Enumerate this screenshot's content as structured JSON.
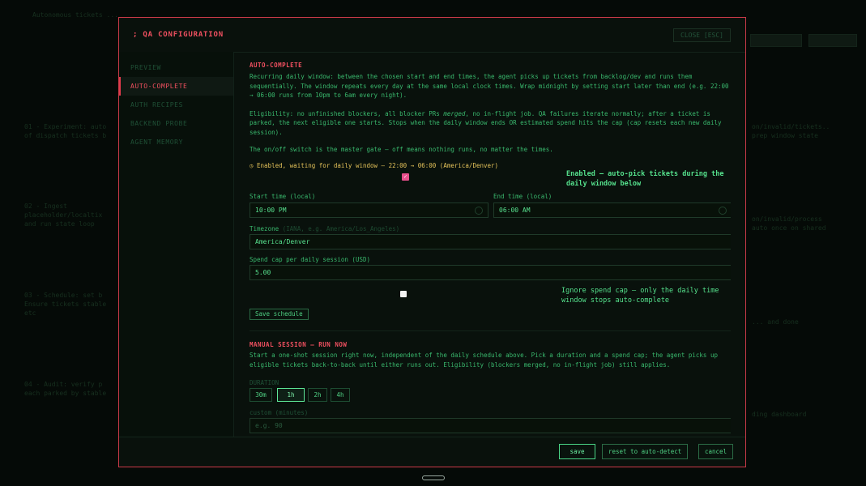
{
  "background": {
    "lines": [
      {
        "text": "Autonomous tickets ..."
      },
      {
        "text": "01 - Experiment: auto",
        "cls": "a"
      },
      {
        "text": "of dispatch tickets b"
      },
      {
        "text": "02 - Ingest"
      },
      {
        "text": "placeholder/localtix"
      },
      {
        "text": "and run state loop"
      },
      {
        "text": "03 - Schedule: set b"
      },
      {
        "text": "Ensure tickets stable"
      },
      {
        "text": "etc"
      },
      {
        "text": "04 - Audit: verify p"
      },
      {
        "text": "each parked by stable"
      },
      {
        "text": "on/invalid/tickets.."
      },
      {
        "text": "prep window state"
      },
      {
        "text": "on/invalid/process"
      },
      {
        "text": "auto once on shared"
      },
      {
        "text": "... and done"
      },
      {
        "text": "ding dashboard"
      }
    ]
  },
  "modal": {
    "title": "; QA CONFIGURATION",
    "close_label": "CLOSE [ESC]"
  },
  "sidebar": {
    "items": [
      {
        "label": "PREVIEW"
      },
      {
        "label": "AUTO-COMPLETE"
      },
      {
        "label": "AUTH RECIPES"
      },
      {
        "label": "BACKEND PROBE"
      },
      {
        "label": "AGENT MEMORY"
      }
    ]
  },
  "auto_complete": {
    "title": "AUTO-COMPLETE",
    "description": "Recurring daily window: between the chosen start and end times, the agent picks up tickets from backlog/dev and runs them sequentially. The window repeats every day at the same local clock times. Wrap midnight by setting start later than end (e.g. 22:00 → 06:00 runs from 10pm to 6am every night).",
    "eligibility_a": "Eligibility: no unfinished blockers, all blocker PRs ",
    "eligibility_em": "merged",
    "eligibility_b": ", no in-flight job. QA failures iterate normally; after a ticket is parked, the next eligible one starts. Stops when the daily window ends OR estimated spend hits the cap (cap resets each new daily session).",
    "master_gate": "The on/off switch is the master gate — off means nothing runs, no matter the times.",
    "status": "◷ Enabled, waiting for daily window — 22:00 → 06:00 (America/Denver)",
    "enabled_hint": "Enabled — auto-pick tickets during the daily window below",
    "start_label": "Start time (local)",
    "start_value": "10:00 PM",
    "end_label": "End time (local)",
    "end_value": "06:00 AM",
    "timezone_label": "Timezone",
    "timezone_sub": "(IANA, e.g. America/Los_Angeles)",
    "timezone_value": "America/Denver",
    "spend_label": "Spend cap per daily session (USD)",
    "spend_value": "5.00",
    "ignore_hint": "Ignore spend cap — only the daily time window stops auto-complete",
    "save_label": "Save schedule"
  },
  "manual": {
    "title": "MANUAL SESSION — RUN NOW",
    "description": "Start a one-shot session right now, independent of the daily schedule above. Pick a duration and a spend cap; the agent picks up eligible tickets back-to-back until either runs out. Eligibility (blockers merged, no in-flight job) still applies.",
    "duration_label": "DURATION",
    "durations": [
      "30m",
      "1h",
      "2h",
      "4h"
    ],
    "selected_duration": "1h",
    "custom_label": "custom (minutes)",
    "custom_placeholder": "e.g. 90"
  },
  "footer": {
    "save": "save",
    "reset": "reset to auto-detect",
    "cancel": "cancel"
  },
  "colors": {
    "accent_red": "#f05060",
    "text_green": "#39b86d",
    "bright_green": "#55e08c",
    "status_yellow": "#e5c35a",
    "checkbox_pink": "#e84f8c"
  }
}
